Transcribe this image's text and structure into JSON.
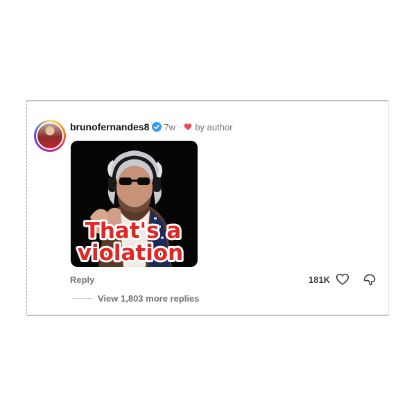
{
  "comment": {
    "username": "brunofernandes8",
    "time": "7w",
    "separator": "·",
    "liked_by": "by author",
    "gif_caption_line1": "That's a",
    "gif_caption_line2": "violation",
    "reply_label": "Reply",
    "like_count": "181K",
    "view_replies": "View 1,803 more replies"
  },
  "colors": {
    "verified": "#3897f0",
    "author_heart": "#ed4956",
    "muted_text": "#737373",
    "caption_red": "#e52521"
  },
  "icons": [
    "verified-badge-icon",
    "heart-icon",
    "like-heart-outline-icon",
    "dislike-icon"
  ]
}
